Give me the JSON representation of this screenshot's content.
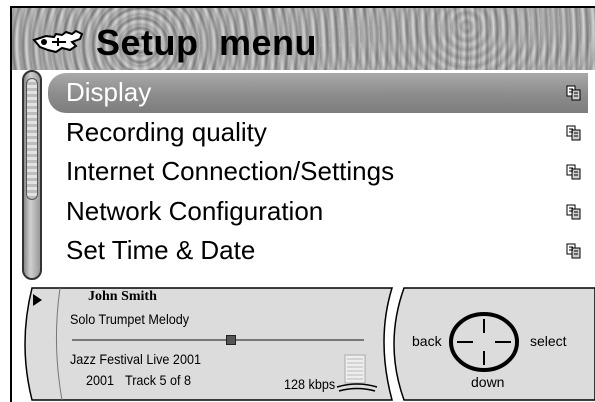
{
  "header": {
    "title": "Setup menu",
    "icon": "hand-wrench-icon"
  },
  "menu": {
    "items": [
      {
        "label": "Display",
        "selected": true,
        "submenu_icon": "submenu-icon"
      },
      {
        "label": "Recording quality",
        "selected": false,
        "submenu_icon": "submenu-icon"
      },
      {
        "label": "Internet Connection/Settings",
        "selected": false,
        "submenu_icon": "submenu-icon"
      },
      {
        "label": "Network Configuration",
        "selected": false,
        "submenu_icon": "submenu-icon"
      },
      {
        "label": "Set Time & Date",
        "selected": false,
        "submenu_icon": "submenu-icon"
      }
    ]
  },
  "player": {
    "state_icon": "play-icon",
    "artist": "John Smith",
    "track": "Solo Trumpet Melody",
    "progress": 0.54,
    "album": "Jazz Festival Live 2001",
    "year": "2001",
    "track_info": "Track 5 of 8",
    "bitrate": "128 kbps",
    "signal_icon": "signal-strength-icon"
  },
  "navigation": {
    "back_label": "back",
    "select_label": "select",
    "down_label": "down",
    "pad_icon": "dpad-icon"
  },
  "colors": {
    "selected_bg": "#8e8e8e",
    "selected_text": "#ffffff",
    "text": "#000000",
    "player_bg": "#d9d9d9"
  }
}
